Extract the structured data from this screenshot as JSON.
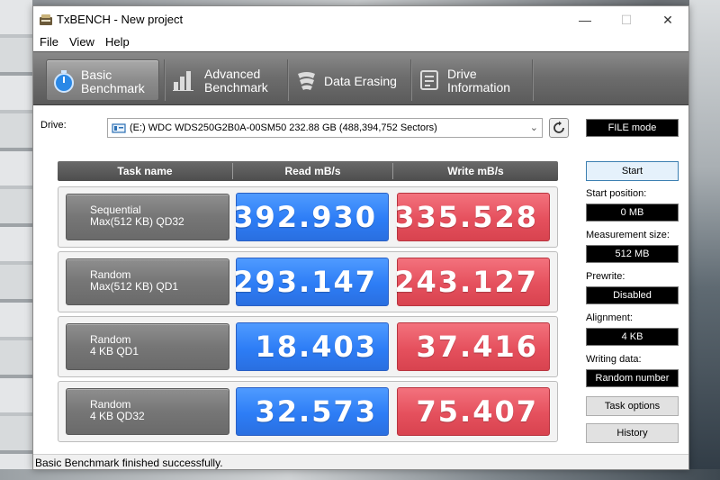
{
  "window": {
    "title": "TxBENCH - New project",
    "controls": {
      "minimize": "—",
      "maximize": "☐",
      "close": "✕"
    }
  },
  "menu": {
    "items": [
      "File",
      "View",
      "Help"
    ]
  },
  "toolbar": {
    "tabs": [
      {
        "line1": "Basic",
        "line2": "Benchmark",
        "icon": "stopwatch-icon",
        "active": true
      },
      {
        "line1": "Advanced",
        "line2": "Benchmark",
        "icon": "bar-chart-icon",
        "active": false
      },
      {
        "line1": "Data Erasing",
        "line2": "",
        "icon": "eraser-icon",
        "active": false
      },
      {
        "line1": "Drive",
        "line2": "Information",
        "icon": "drive-info-icon",
        "active": false
      }
    ]
  },
  "drive": {
    "label": "Drive:",
    "selected": "(E:) WDC WDS250G2B0A-00SM50  232.88 GB (488,394,752 Sectors)",
    "mode": "FILE mode"
  },
  "benchmark": {
    "headers": {
      "task": "Task name",
      "read": "Read mB/s",
      "write": "Write mB/s"
    },
    "rows": [
      {
        "line1": "Sequential",
        "line2": "Max(512 KB) QD32",
        "read": "392.930",
        "write": "335.528"
      },
      {
        "line1": "Random",
        "line2": "Max(512 KB) QD1",
        "read": "293.147",
        "write": "243.127"
      },
      {
        "line1": "Random",
        "line2": "4 KB QD1",
        "read": "18.403",
        "write": "37.416"
      },
      {
        "line1": "Random",
        "line2": "4 KB QD32",
        "read": "32.573",
        "write": "75.407"
      }
    ],
    "colors": {
      "read": "#2d7df6",
      "write": "#e5505d"
    }
  },
  "side": {
    "start_label": "Start",
    "start_position": {
      "label": "Start position:",
      "value": "0 MB"
    },
    "measurement_size": {
      "label": "Measurement size:",
      "value": "512 MB"
    },
    "prewrite": {
      "label": "Prewrite:",
      "value": "Disabled"
    },
    "alignment": {
      "label": "Alignment:",
      "value": "4 KB"
    },
    "writing_data": {
      "label": "Writing data:",
      "value": "Random number"
    },
    "task_options_label": "Task options",
    "history_label": "History"
  },
  "status": {
    "text": "Basic Benchmark finished successfully."
  }
}
